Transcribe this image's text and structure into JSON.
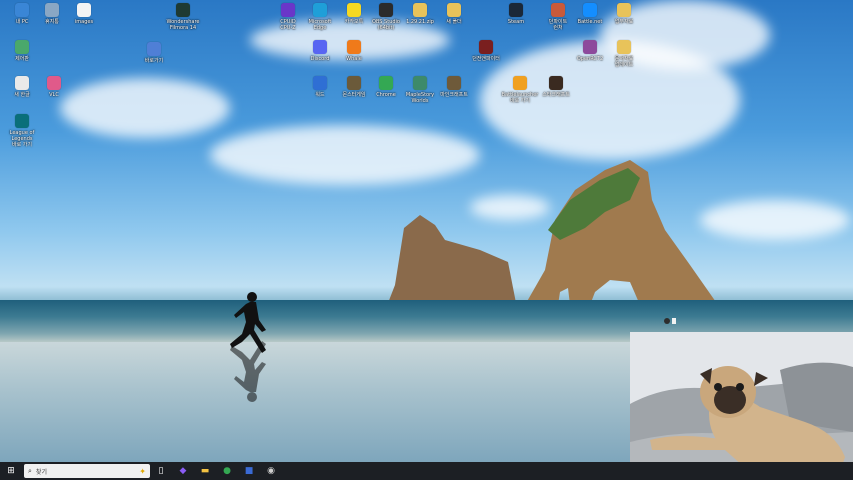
{
  "desktop_icons": [
    {
      "id": "pc",
      "label": "내 PC",
      "icon": "computer-icon",
      "color": "#3a86d6"
    },
    {
      "id": "recycle",
      "label": "휴지통",
      "icon": "recycle-bin-icon",
      "color": "#8aa7c4"
    },
    {
      "id": "images",
      "label": "images",
      "icon": "file-icon",
      "color": "#f4f4f4"
    },
    {
      "id": "filmora",
      "label": "Wondershare\nFilmora 14",
      "icon": "filmora-icon",
      "color": "#1e3a33"
    },
    {
      "id": "cpuid",
      "label": "CPUID\nCPU-Z",
      "icon": "cpuz-icon",
      "color": "#6a36c9"
    },
    {
      "id": "edge",
      "label": "Microsoft\nEdge",
      "icon": "edge-icon",
      "color": "#1f9fd8"
    },
    {
      "id": "kakaotalk",
      "label": "카카오톡",
      "icon": "kakaotalk-icon",
      "color": "#f5d923"
    },
    {
      "id": "obs",
      "label": "OBS Studio\n(64bit)",
      "icon": "obs-icon",
      "color": "#2b2b2b"
    },
    {
      "id": "zip",
      "label": "1.29.21.zip",
      "icon": "folder-icon",
      "color": "#e8c35a"
    },
    {
      "id": "folder1",
      "label": "새 폴더",
      "icon": "folder-icon",
      "color": "#e8c35a"
    },
    {
      "id": "steam",
      "label": "Steam",
      "icon": "steam-icon",
      "color": "#1b2838"
    },
    {
      "id": "nexon",
      "label": "던파이트\n런처",
      "icon": "game-icon",
      "color": "#c95a3a"
    },
    {
      "id": "battlenet",
      "label": "Battle.net",
      "icon": "battlenet-icon",
      "color": "#148eff"
    },
    {
      "id": "folder2",
      "label": "업무자료",
      "icon": "folder-icon",
      "color": "#e8c35a"
    },
    {
      "id": "control",
      "label": "제어판",
      "icon": "control-panel-icon",
      "color": "#4aa86b"
    },
    {
      "id": "shortcut",
      "label": "바로가기",
      "icon": "shortcut-icon",
      "color": "#4f7fd6"
    },
    {
      "id": "discord",
      "label": "Discord",
      "icon": "discord-icon",
      "color": "#5865f2"
    },
    {
      "id": "whale",
      "label": "Whale",
      "icon": "whale-icon",
      "color": "#f07a1a"
    },
    {
      "id": "game2",
      "label": "던전앤파이터",
      "icon": "dnf-icon",
      "color": "#7a1f1f"
    },
    {
      "id": "openrct",
      "label": "OpenRCT2",
      "icon": "openrct-icon",
      "color": "#8d4a9c"
    },
    {
      "id": "folder3",
      "label": "문서자료\n업데이트",
      "icon": "folder-icon",
      "color": "#e8c35a"
    },
    {
      "id": "hwp",
      "label": "새 한글",
      "icon": "document-icon",
      "color": "#e9e9e9"
    },
    {
      "id": "vlc",
      "label": "VLC",
      "icon": "image-icon",
      "color": "#e05a8a"
    },
    {
      "id": "word",
      "label": "워드",
      "icon": "document-icon",
      "color": "#2f6fd4"
    },
    {
      "id": "game3",
      "label": "몬스터게임",
      "icon": "game-icon",
      "color": "#6b5a3a"
    },
    {
      "id": "chrome",
      "label": "Chrome",
      "icon": "chrome-icon",
      "color": "#34a853"
    },
    {
      "id": "maplestory",
      "label": "MapleStory\nWorlds",
      "icon": "maplestory-icon",
      "color": "#3d8a6a"
    },
    {
      "id": "minecraft",
      "label": "마인크래프트",
      "icon": "minecraft-icon",
      "color": "#6e5a3a"
    },
    {
      "id": "battlelauncher",
      "label": "Battlelauncher\n바로 가기",
      "icon": "battlelauncher-icon",
      "color": "#f0a020"
    },
    {
      "id": "lol",
      "label": "스타크래프트",
      "icon": "starcraft-icon",
      "color": "#3a2a20"
    },
    {
      "id": "league",
      "label": "League of Legends\n바로 가기",
      "icon": "league-icon",
      "color": "#0a6f7a"
    }
  ],
  "taskbar": {
    "start_label": "⊞",
    "search_placeholder": "찾기",
    "copilot_label": "✦",
    "items": [
      {
        "name": "taskview-icon",
        "glyph": "▯",
        "color": "#ffffff"
      },
      {
        "name": "copilot-icon",
        "glyph": "◆",
        "color": "#8a5cf5"
      },
      {
        "name": "file-explorer-icon",
        "glyph": "▬",
        "color": "#f3c243"
      },
      {
        "name": "chrome-icon",
        "glyph": "●",
        "color": "#34a853"
      },
      {
        "name": "app-icon",
        "glyph": "■",
        "color": "#3a6ad4"
      },
      {
        "name": "obs-icon",
        "glyph": "◉",
        "color": "#cfcfcf"
      }
    ]
  }
}
